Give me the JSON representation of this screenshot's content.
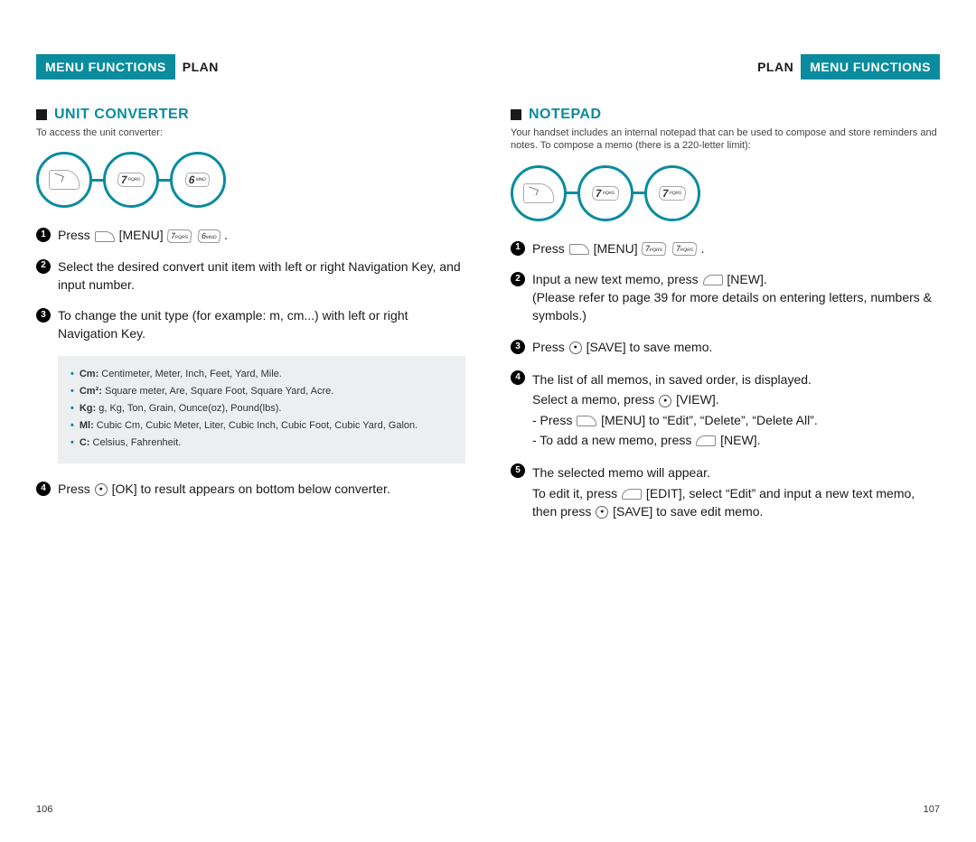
{
  "header": {
    "badge": "MENU FUNCTIONS",
    "section": "PLAN"
  },
  "left": {
    "title": "UNIT CONVERTER",
    "intro": "To access the unit converter:",
    "keys": [
      "softkey",
      "7 PQRS",
      "6 MNO"
    ],
    "steps": [
      {
        "n": "1",
        "parts": [
          "Press",
          "[softkey]",
          "[MENU]",
          "[7]",
          "[6]",
          "."
        ]
      },
      {
        "n": "2",
        "text": "Select the desired convert unit item with left or right Navigation Key, and input number."
      },
      {
        "n": "3",
        "text": "To change the unit type (for example: m, cm...) with left or right Navigation Key."
      },
      {
        "n": "4",
        "parts": [
          "Press ",
          "[ok]",
          " [OK] to result appears on bottom below converter."
        ]
      }
    ],
    "info": [
      {
        "label": "Cm:",
        "text": " Centimeter, Meter, Inch, Feet, Yard, Mile."
      },
      {
        "label": "Cm²:",
        "text": " Square meter, Are, Square Foot, Square Yard, Acre."
      },
      {
        "label": "Kg:",
        "text": " g, Kg, Ton, Grain, Ounce(oz), Pound(lbs)."
      },
      {
        "label": "Ml:",
        "text": " Cubic Cm, Cubic Meter, Liter, Cubic Inch, Cubic Foot, Cubic Yard, Galon."
      },
      {
        "label": "C:",
        "text": " Celsius, Fahrenheit."
      }
    ],
    "page": "106"
  },
  "right": {
    "title": "NOTEPAD",
    "intro": "Your handset includes an internal notepad that can be used to compose and store reminders and notes. To compose a memo (there is a 220-letter limit):",
    "keys": [
      "softkey",
      "7 PQRS",
      "7 PQRS"
    ],
    "steps": [
      {
        "n": "1",
        "parts": [
          "Press",
          "[softkey]",
          "[MENU]",
          "[7]",
          "[7]",
          "."
        ]
      },
      {
        "n": "2",
        "parts": [
          "Input a new text memo, press",
          "[rightsk]",
          "[NEW].",
          "\n(Please refer to page 39 for more details on entering letters, numbers & symbols.)"
        ]
      },
      {
        "n": "3",
        "parts": [
          "Press ",
          "[ok]",
          " [SAVE] to save memo."
        ]
      },
      {
        "n": "4",
        "lines": [
          "The list of all memos, in saved order, is displayed.",
          {
            "parts": [
              "Select a memo, press ",
              "[ok]",
              " [VIEW]."
            ]
          },
          {
            "parts": [
              "- Press",
              "[softkey]",
              "[MENU] to “Edit”, “Delete”, “Delete All”."
            ]
          },
          {
            "parts": [
              "- To add a new memo, press",
              "[rightsk]",
              "[NEW]."
            ]
          }
        ]
      },
      {
        "n": "5",
        "lines": [
          "The selected memo will appear.",
          {
            "parts": [
              "To edit it, press",
              "[rightsk]",
              "[EDIT], select “Edit” and input a new text memo, then press ",
              "[ok]",
              " [SAVE] to save edit memo."
            ]
          }
        ]
      }
    ],
    "page": "107"
  }
}
